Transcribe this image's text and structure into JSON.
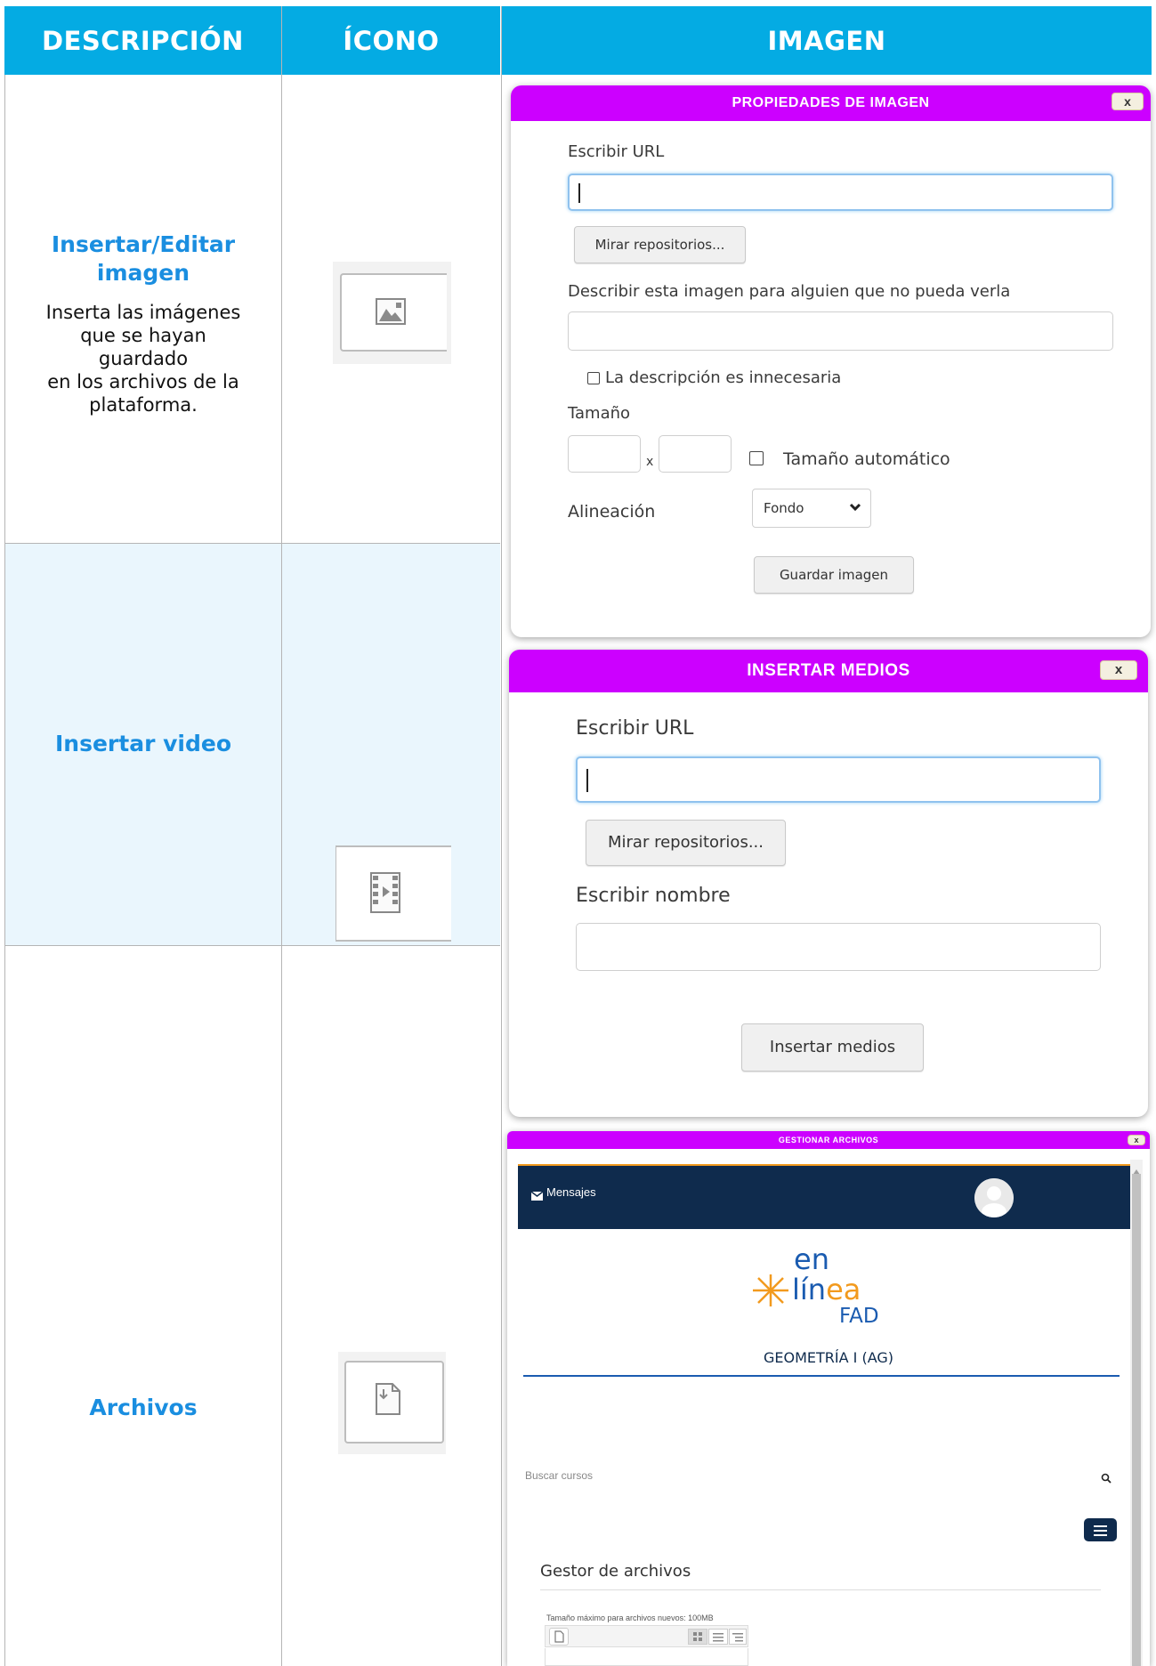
{
  "headers": {
    "descripcion": "DESCRIPCIÓN",
    "icono": "ÍCONO",
    "imagen": "IMAGEN"
  },
  "rows": [
    {
      "title": "Insertar/Editar imagen",
      "title_line1": "Insertar/Editar",
      "title_line2": "imagen",
      "body_lines": [
        "Inserta las imágenes",
        "que se hayan guardado",
        "en los archivos de la",
        "plataforma."
      ],
      "icon": "image-icon"
    },
    {
      "title": "Insertar video",
      "icon": "video-icon"
    },
    {
      "title": "Archivos",
      "icon": "file-icon"
    }
  ],
  "image_dialog": {
    "title": "PROPIEDADES DE IMAGEN",
    "close": "x",
    "url_label": "Escribir URL",
    "browse_button": "Mirar repositorios...",
    "describe_label": "Describir esta imagen para alguien que no pueda verla",
    "no_desc_label": "La descripción es innecesaria",
    "size_label": "Tamaño",
    "size_x": "x",
    "auto_size_label": "Tamaño automático",
    "align_label": "Alineación",
    "align_value": "Fondo",
    "save_button": "Guardar imagen"
  },
  "media_dialog": {
    "title": "INSERTAR MEDIOS",
    "close": "x",
    "url_label": "Escribir URL",
    "browse_button": "Mirar repositorios...",
    "name_label": "Escribir nombre",
    "insert_button": "Insertar medios"
  },
  "files_dialog": {
    "title": "GESTIONAR ARCHIVOS",
    "close": "x",
    "messages": "Mensajes",
    "logo_en": "en",
    "logo_linea_1": "lín",
    "logo_linea_2": "ea",
    "logo_fad": "FAD",
    "course": "GEOMETRÍA I (AG)",
    "search_placeholder": "Buscar cursos",
    "manager_title": "Gestor de archivos",
    "max_size": "Tamaño máximo para archivos nuevos: 100MB"
  },
  "colors": {
    "header": "#04abe3",
    "title_blue": "#1a8ee0",
    "dialog_title": "#cc00ff",
    "site_bar": "#0f2b4d",
    "row2_bg": "#eaf6fd",
    "logo_orange": "#f29a1e",
    "logo_blue": "#1a5bb0"
  }
}
